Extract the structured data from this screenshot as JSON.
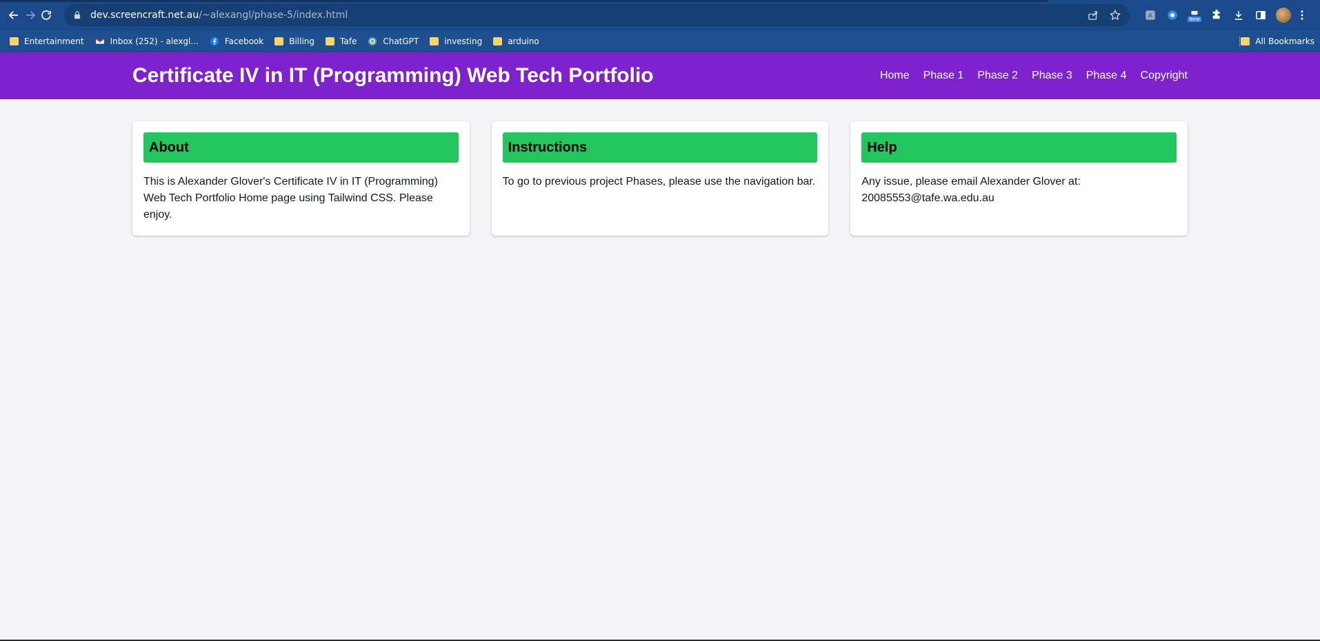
{
  "browser": {
    "url_host": "dev.screencraft.net.au",
    "url_path": "/~alexangl/phase-5/index.html",
    "bookmarks": [
      {
        "label": "Entertainment",
        "icon": "folder-icon"
      },
      {
        "label": "Inbox (252) - alexgl...",
        "icon": "gmail-icon"
      },
      {
        "label": "Facebook",
        "icon": "facebook-icon"
      },
      {
        "label": "Billing",
        "icon": "folder-icon"
      },
      {
        "label": "Tafe",
        "icon": "folder-icon"
      },
      {
        "label": "ChatGPT",
        "icon": "chatgpt-icon"
      },
      {
        "label": "investing",
        "icon": "folder-icon"
      },
      {
        "label": "arduino",
        "icon": "folder-icon"
      }
    ],
    "all_bookmarks": "All Bookmarks",
    "ext_new_label": "New"
  },
  "header": {
    "title": "Certificate IV in IT (Programming) Web Tech Portfolio",
    "nav": [
      "Home",
      "Phase 1",
      "Phase 2",
      "Phase 3",
      "Phase 4",
      "Copyright"
    ]
  },
  "cards": [
    {
      "heading": "About",
      "body": "This is Alexander Glover's Certificate IV in IT (Programming) Web Tech Portfolio Home page using Tailwind CSS. Please enjoy."
    },
    {
      "heading": "Instructions",
      "body": "To go to previous project Phases, please use the navigation bar."
    },
    {
      "heading": "Help",
      "body": "Any issue, please email Alexander Glover at: 20085553@tafe.wa.edu.au"
    }
  ],
  "colors": {
    "header_bg": "#7e22ce",
    "card_heading_bg": "#22c55e",
    "page_bg": "#f3f4f6",
    "browser_chrome": "#1e4f8f"
  }
}
